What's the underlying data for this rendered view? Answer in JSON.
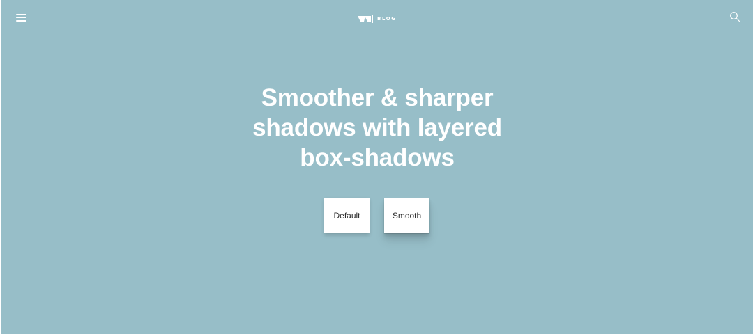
{
  "header": {
    "menu_icon": "hamburger-menu-icon",
    "brand_logo_icon": "brand-logo-icon",
    "brand_label": "BLOG",
    "search_icon": "search-icon"
  },
  "hero": {
    "title_lines": [
      "Smoother & sharper",
      "shadows with layered",
      "box-shadows"
    ]
  },
  "demos": {
    "default_label": "Default",
    "smooth_label": "Smooth"
  },
  "colors": {
    "background": "#97bec8",
    "text": "#ffffff",
    "box_background": "#ffffff",
    "box_text": "#2b2b2b"
  }
}
